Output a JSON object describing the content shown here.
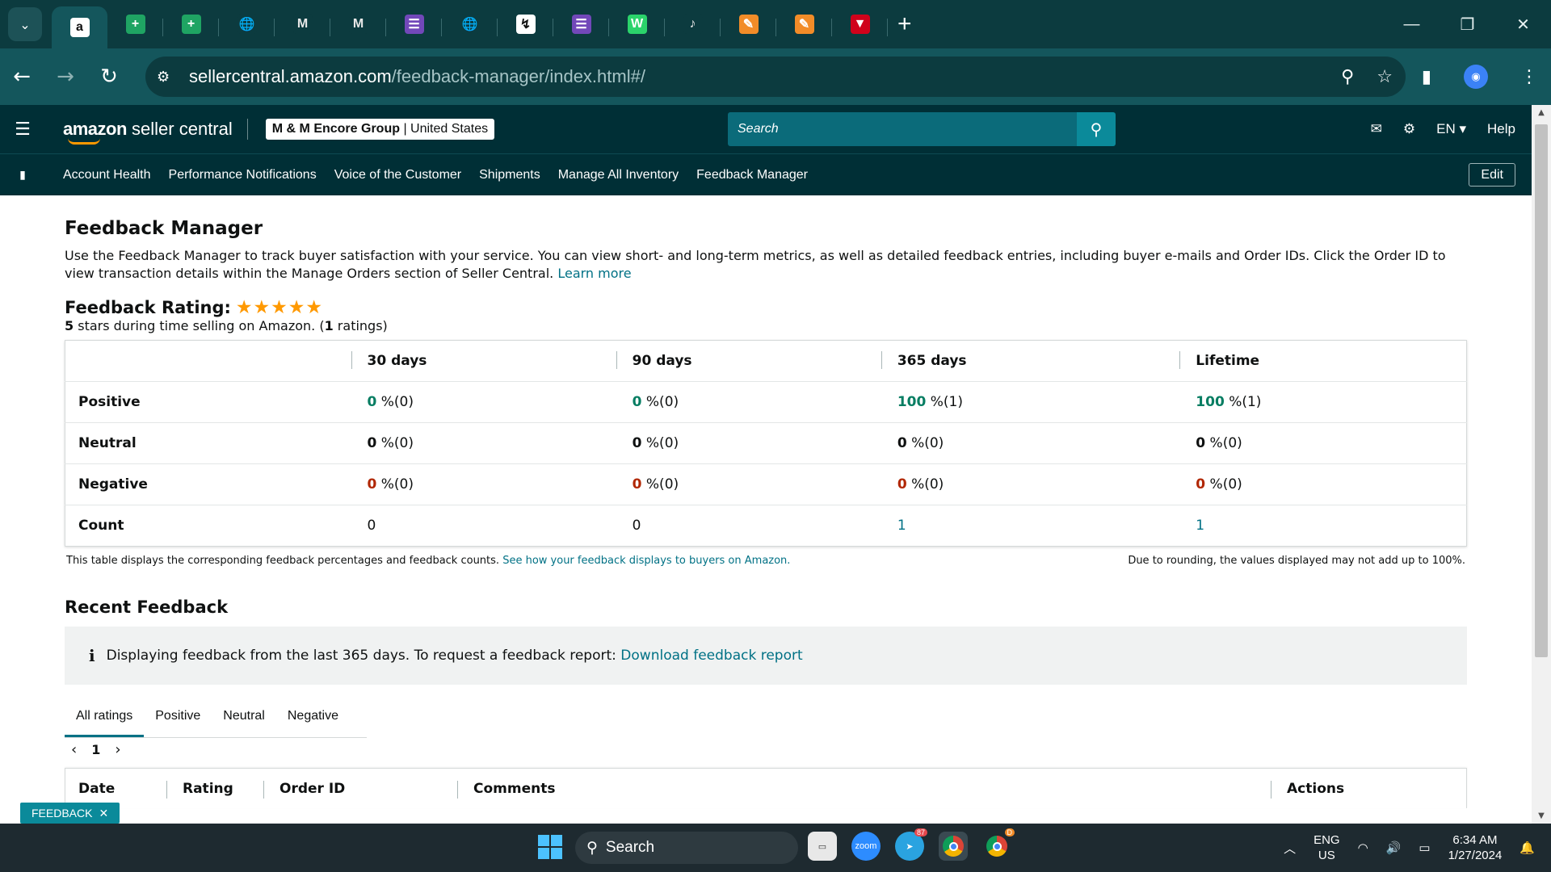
{
  "browser": {
    "tabs": [
      {
        "icon": "amazon-icon",
        "glyph": "a",
        "color": "#ffffff"
      },
      {
        "icon": "sheets-icon",
        "glyph": "+",
        "color": "#1fa463"
      },
      {
        "icon": "sheets-icon",
        "glyph": "+",
        "color": "#1fa463"
      },
      {
        "icon": "globe-icon",
        "glyph": "🌐",
        "color": "#0c3b3f"
      },
      {
        "icon": "gmail-icon",
        "glyph": "M",
        "color": "#0c3b3f"
      },
      {
        "icon": "gmail-icon",
        "glyph": "M",
        "color": "#0c3b3f"
      },
      {
        "icon": "forms-icon",
        "glyph": "☰",
        "color": "#7248b9"
      },
      {
        "icon": "globe-icon",
        "glyph": "🌐",
        "color": "#0c3b3f"
      },
      {
        "icon": "chart-icon",
        "glyph": "↯",
        "color": "#ffffff"
      },
      {
        "icon": "forms-icon",
        "glyph": "☰",
        "color": "#7248b9"
      },
      {
        "icon": "w-icon",
        "glyph": "W",
        "color": "#2bd36b"
      },
      {
        "icon": "tiktok-icon",
        "glyph": "♪",
        "color": "#0c3b3f"
      },
      {
        "icon": "pencil-icon",
        "glyph": "✎",
        "color": "#f28c28"
      },
      {
        "icon": "pencil-icon",
        "glyph": "✎",
        "color": "#f28c28"
      },
      {
        "icon": "app-icon",
        "glyph": "▼",
        "color": "#d0021b"
      }
    ],
    "url_host": "sellercentral.amazon.com",
    "url_path": "/feedback-manager/index.html#/"
  },
  "header": {
    "logo_amazon": "amazon",
    "logo_rest": " seller central",
    "account_name": "M & M Encore Group",
    "account_region": "United States",
    "search_placeholder": "Search",
    "lang": "EN",
    "help": "Help"
  },
  "nav": {
    "items": [
      "Account Health",
      "Performance Notifications",
      "Voice of the Customer",
      "Shipments",
      "Manage All Inventory",
      "Feedback Manager"
    ],
    "edit": "Edit"
  },
  "page": {
    "title": "Feedback Manager",
    "intro": "Use the Feedback Manager to track buyer satisfaction with your service. You can view short- and long-term metrics, as well as detailed feedback entries, including buyer e-mails and Order IDs. Click the Order ID to view transaction details within the Manage Orders section of Seller Central.",
    "learn_more": "Learn more",
    "rating_title": "Feedback Rating:",
    "stars": "★★★★★",
    "rating_stars_value": 5,
    "rating_sub_stars": "5",
    "rating_sub_mid": " stars during time selling on Amazon. (",
    "rating_sub_count": "1",
    "rating_sub_end": " ratings)"
  },
  "metrics": {
    "columns": [
      "30 days",
      "90 days",
      "365 days",
      "Lifetime"
    ],
    "rows": [
      {
        "label": "Positive",
        "cells": [
          [
            "0",
            "%(0)"
          ],
          [
            "0",
            "%(0)"
          ],
          [
            "100",
            "%(1)"
          ],
          [
            "100",
            "%(1)"
          ]
        ]
      },
      {
        "label": "Neutral",
        "cells": [
          [
            "0",
            "%(0)"
          ],
          [
            "0",
            "%(0)"
          ],
          [
            "0",
            "%(0)"
          ],
          [
            "0",
            "%(0)"
          ]
        ]
      },
      {
        "label": "Negative",
        "cells": [
          [
            "0",
            "%(0)"
          ],
          [
            "0",
            "%(0)"
          ],
          [
            "0",
            "%(0)"
          ],
          [
            "0",
            "%(0)"
          ]
        ]
      },
      {
        "label": "Count",
        "cells": [
          [
            "0",
            ""
          ],
          [
            "0",
            ""
          ],
          [
            "1",
            ""
          ],
          [
            "1",
            ""
          ]
        ]
      }
    ],
    "footnote": "This table displays the corresponding feedback percentages and feedback counts.",
    "footnote_link": "See how your feedback displays to buyers on Amazon.",
    "rounding_note": "Due to rounding, the values displayed may not add up to 100%."
  },
  "recent": {
    "title": "Recent Feedback",
    "alert_text": "Displaying feedback from the last 365 days. To request a feedback report:",
    "alert_link": "Download feedback report",
    "tabs": [
      "All ratings",
      "Positive",
      "Neutral",
      "Negative"
    ],
    "page": "1",
    "columns": [
      "Date",
      "Rating",
      "Order ID",
      "Comments",
      "Actions"
    ]
  },
  "feedback_pill": "FEEDBACK",
  "taskbar": {
    "search": "Search",
    "lang_line1": "ENG",
    "lang_line2": "US",
    "time": "6:34 AM",
    "date": "1/27/2024",
    "telegram_badge": "87",
    "chrome_badge": "D"
  }
}
